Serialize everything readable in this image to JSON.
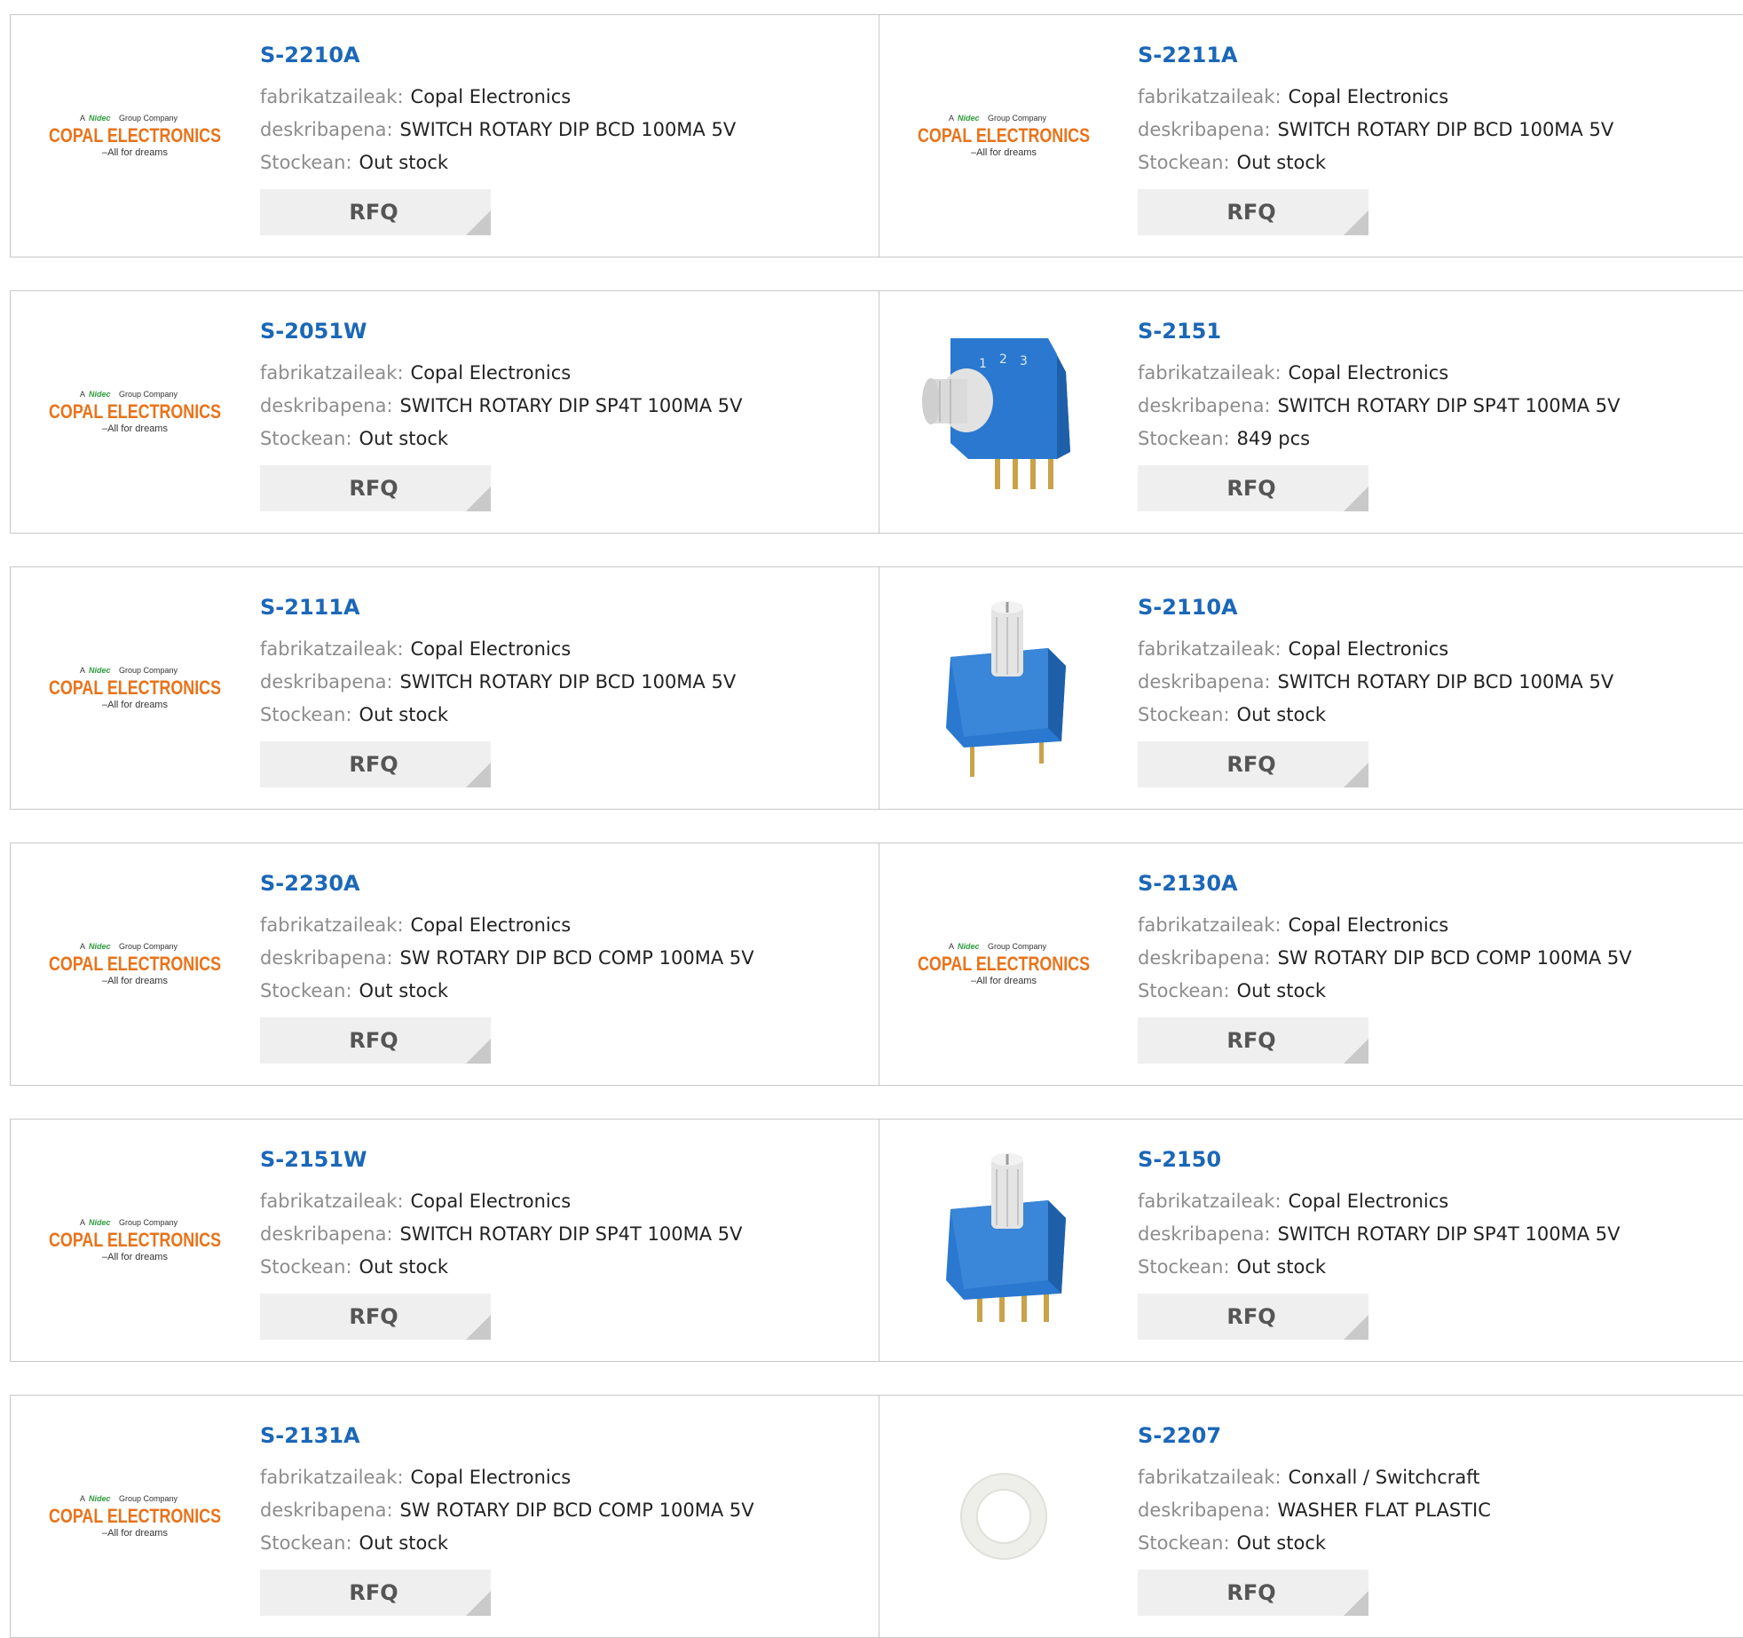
{
  "labels": {
    "manufacturer": "fabrikatzaileak:",
    "description": "deskribapena:",
    "stock": "Stockean:",
    "rfq": "RFQ"
  },
  "logo": {
    "line1_prefix": "A",
    "line1_brand": "Nidec",
    "line1_suffix": "Group Company",
    "line2": "COPAL ELECTRONICS",
    "line3": "–All for dreams"
  },
  "colors": {
    "part_number": "#1b67b8",
    "logo_orange": "#e8731b",
    "nidec_green": "#2e9a3c",
    "switch_blue": "#2a78cf"
  },
  "products": [
    {
      "part": "S-2210A",
      "manufacturer": "Copal Electronics",
      "description": "SWITCH ROTARY DIP BCD 100MA 5V",
      "stock": "Out stock",
      "image": "copal-logo"
    },
    {
      "part": "S-2211A",
      "manufacturer": "Copal Electronics",
      "description": "SWITCH ROTARY DIP BCD 100MA 5V",
      "stock": "Out stock",
      "image": "copal-logo"
    },
    {
      "part": "S-2051W",
      "manufacturer": "Copal Electronics",
      "description": "SWITCH ROTARY DIP SP4T 100MA 5V",
      "stock": "Out stock",
      "image": "copal-logo"
    },
    {
      "part": "S-2151",
      "manufacturer": "Copal Electronics",
      "description": "SWITCH ROTARY DIP SP4T 100MA 5V",
      "stock": "849 pcs",
      "image": "rotary-switch-angled"
    },
    {
      "part": "S-2111A",
      "manufacturer": "Copal Electronics",
      "description": "SWITCH ROTARY DIP BCD 100MA 5V",
      "stock": "Out stock",
      "image": "copal-logo"
    },
    {
      "part": "S-2110A",
      "manufacturer": "Copal Electronics",
      "description": "SWITCH ROTARY DIP BCD 100MA 5V",
      "stock": "Out stock",
      "image": "rotary-switch-knob"
    },
    {
      "part": "S-2230A",
      "manufacturer": "Copal Electronics",
      "description": "SW ROTARY DIP BCD COMP 100MA 5V",
      "stock": "Out stock",
      "image": "copal-logo"
    },
    {
      "part": "S-2130A",
      "manufacturer": "Copal Electronics",
      "description": "SW ROTARY DIP BCD COMP 100MA 5V",
      "stock": "Out stock",
      "image": "copal-logo"
    },
    {
      "part": "S-2151W",
      "manufacturer": "Copal Electronics",
      "description": "SWITCH ROTARY DIP SP4T 100MA 5V",
      "stock": "Out stock",
      "image": "copal-logo"
    },
    {
      "part": "S-2150",
      "manufacturer": "Copal Electronics",
      "description": "SWITCH ROTARY DIP SP4T 100MA 5V",
      "stock": "Out stock",
      "image": "rotary-switch-knob-pins"
    },
    {
      "part": "S-2131A",
      "manufacturer": "Copal Electronics",
      "description": "SW ROTARY DIP BCD COMP 100MA 5V",
      "stock": "Out stock",
      "image": "copal-logo"
    },
    {
      "part": "S-2207",
      "manufacturer": "Conxall / Switchcraft",
      "description": "WASHER FLAT PLASTIC",
      "stock": "Out stock",
      "image": "washer"
    }
  ]
}
